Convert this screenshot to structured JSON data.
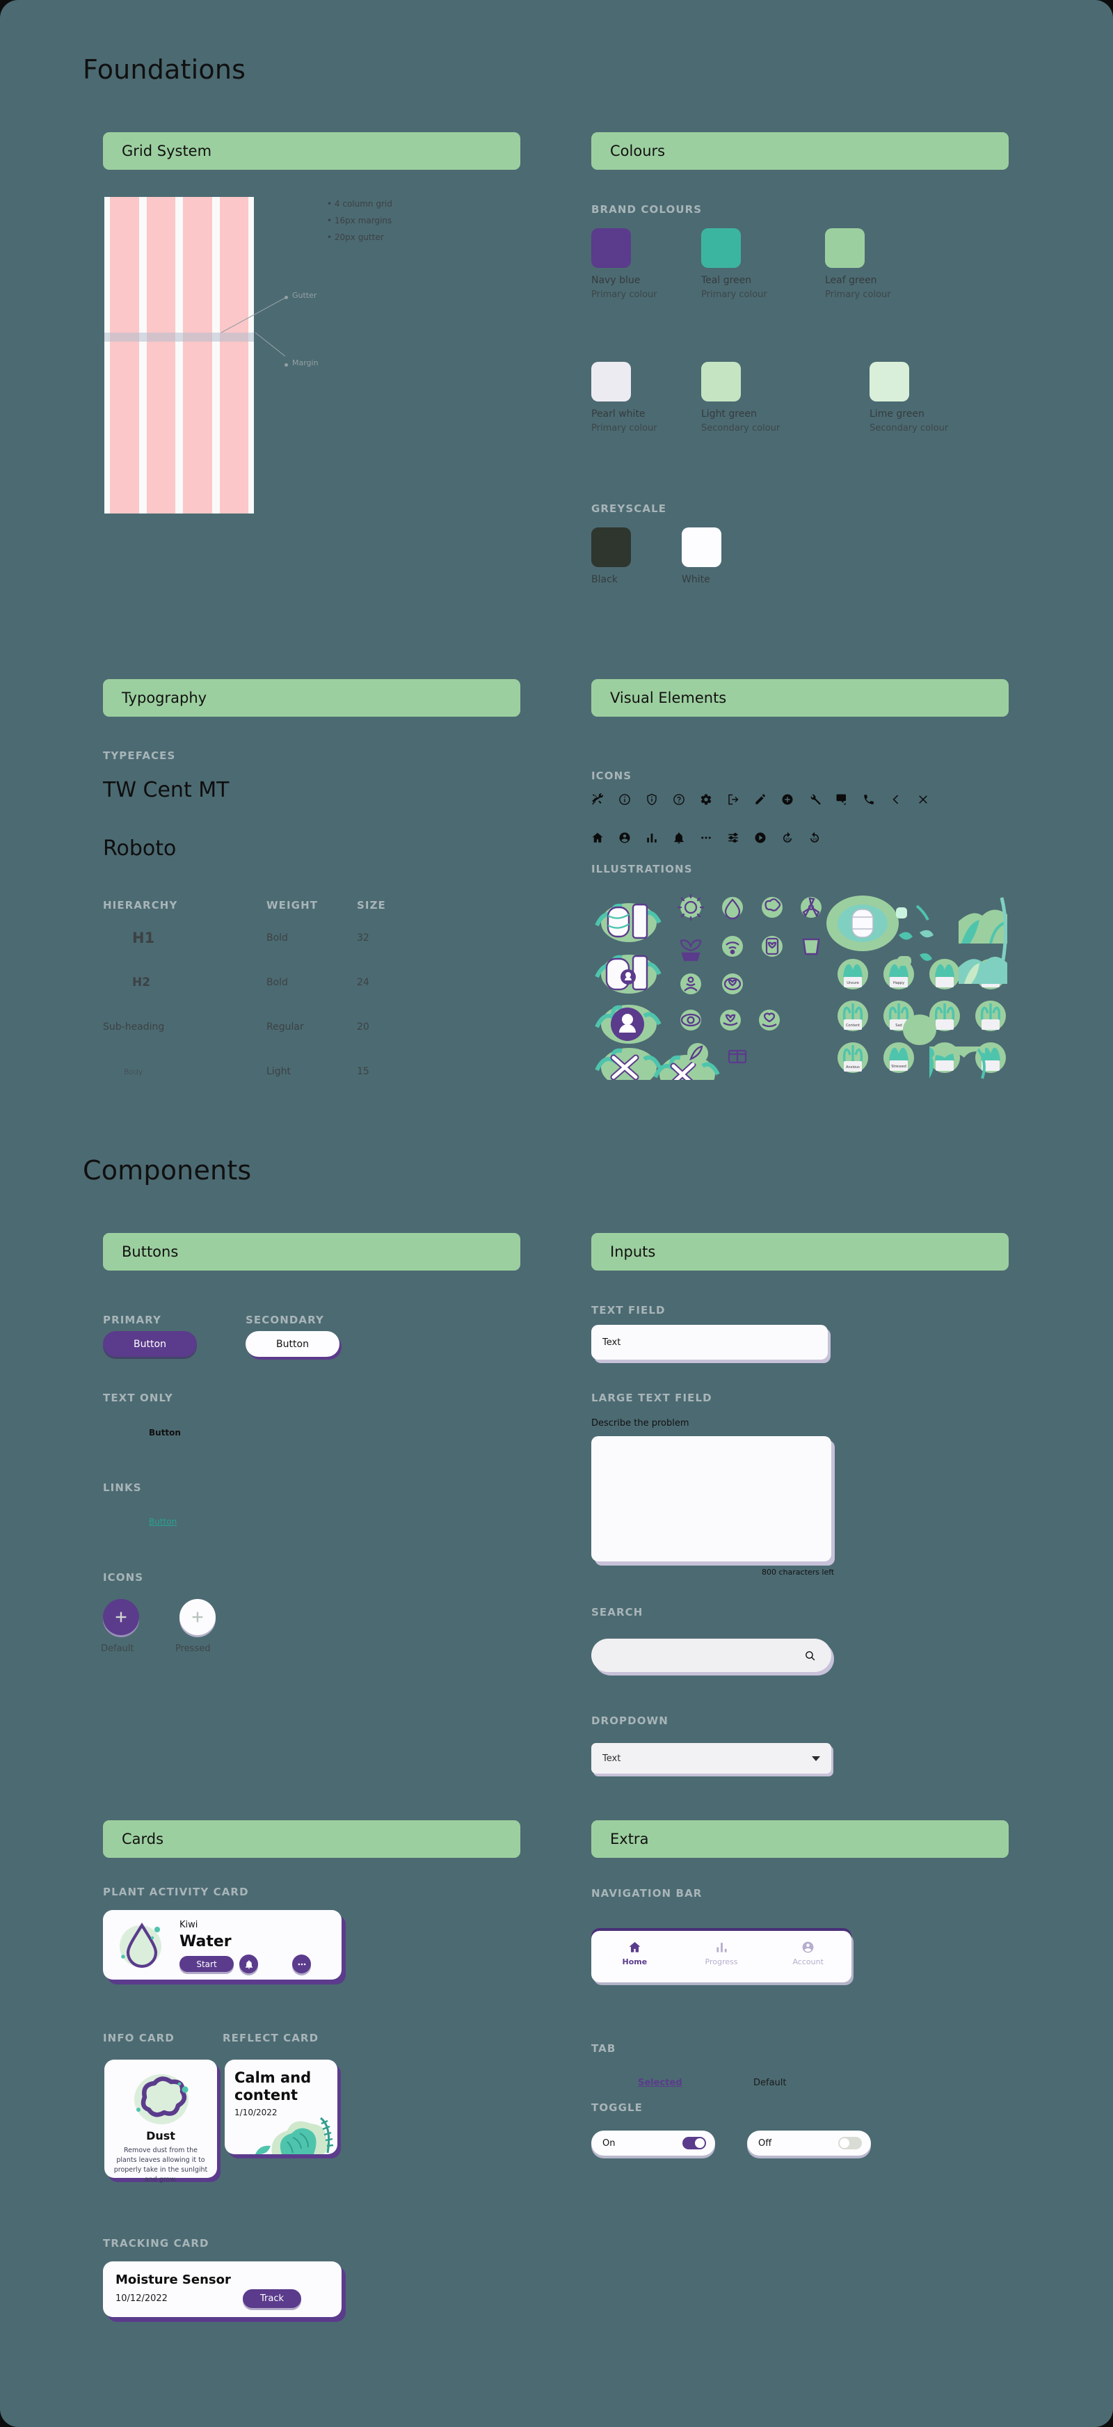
{
  "colors": {
    "canvas_bg": "#4c6a72",
    "panel_header": "#9ccf9f",
    "navy_blue": "#5b3b8c",
    "teal_green": "#3cb5a0",
    "leaf_green": "#9ccf9f",
    "pearl_white": "#edebf2",
    "light_green": "#c5e5c2",
    "lime_green": "#d9efd9",
    "black": "#2e362e",
    "white": "#fdfdff",
    "label_grey": "#a8b5b8",
    "grid_column": "#fbc7c8"
  },
  "sections": {
    "foundations_title": "Foundations",
    "components_title": "Components"
  },
  "grid_system": {
    "panel_title": "Grid System",
    "bullets": [
      "4 column grid",
      "16px margins",
      "20px gutter"
    ],
    "annotations": {
      "gutter": "Gutter",
      "margin": "Margin"
    },
    "columns": 4
  },
  "colours": {
    "panel_title": "Colours",
    "brand_label": "BRAND COLOURS",
    "greyscale_label": "GREYSCALE",
    "brand": [
      {
        "name": "Navy blue",
        "role": "Primary colour",
        "hex": "#5b3b8c"
      },
      {
        "name": "Teal green",
        "role": "Primary colour",
        "hex": "#3cb5a0"
      },
      {
        "name": "Leaf green",
        "role": "Primary colour",
        "hex": "#9ccf9f"
      },
      {
        "name": "Pearl white",
        "role": "Primary colour",
        "hex": "#edebf2"
      },
      {
        "name": "Light green",
        "role": "Secondary colour",
        "hex": "#c5e5c2"
      },
      {
        "name": "Lime green",
        "role": "Secondary colour",
        "hex": "#d9efd9"
      }
    ],
    "greyscale": [
      {
        "name": "Black",
        "hex": "#2e362e"
      },
      {
        "name": "White",
        "hex": "#fdfdff"
      }
    ]
  },
  "typography": {
    "panel_title": "Typography",
    "typefaces_label": "TYPEFACES",
    "typefaces": [
      "TW Cent MT",
      "Roboto"
    ],
    "table_headers": [
      "HIERARCHY",
      "WEIGHT",
      "SIZE"
    ],
    "rows": [
      {
        "hierarchy": "H1",
        "weight": "Bold",
        "size": "32"
      },
      {
        "hierarchy": "H2",
        "weight": "Bold",
        "size": "24"
      },
      {
        "hierarchy": "Sub-heading",
        "weight": "Regular",
        "size": "20"
      },
      {
        "hierarchy": "Body",
        "weight": "Light",
        "size": "15"
      }
    ]
  },
  "visual_elements": {
    "panel_title": "Visual Elements",
    "icons_label": "ICONS",
    "illustrations_label": "ILLUSTRATIONS",
    "icons_row1": [
      "tools-icon",
      "info-circle-icon",
      "shield-info-icon",
      "help-circle-icon",
      "gear-icon",
      "logout-icon",
      "pencil-icon",
      "add-circle-icon",
      "wrench-icon",
      "chat-icon",
      "phone-icon",
      "chevron-left-icon",
      "close-icon"
    ],
    "icons_row2": [
      "home-icon",
      "account-circle-icon",
      "bar-chart-icon",
      "bell-icon",
      "more-horizontal-icon",
      "tune-icon",
      "play-circle-icon",
      "forward-10-icon",
      "replay-10-icon"
    ]
  },
  "buttons": {
    "panel_title": "Buttons",
    "primary_label": "PRIMARY",
    "secondary_label": "SECONDARY",
    "text_only_label": "TEXT ONLY",
    "links_label": "LINKS",
    "icons_label": "ICONS",
    "primary_text": "Button",
    "secondary_text": "Button",
    "text_only_text": "Button",
    "link_text": "Button",
    "icon_default_caption": "Default",
    "icon_pressed_caption": "Pressed"
  },
  "inputs": {
    "panel_title": "Inputs",
    "text_field_label": "TEXT FIELD",
    "text_field_value": "Text",
    "large_text_field_label": "LARGE TEXT FIELD",
    "large_text_field_prompt": "Describe the problem",
    "large_text_field_counter": "800 characters left",
    "search_label": "SEARCH",
    "search_placeholder": "",
    "dropdown_label": "DROPDOWN",
    "dropdown_value": "Text"
  },
  "cards": {
    "panel_title": "Cards",
    "plant_activity_label": "PLANT ACTIVITY CARD",
    "plant_activity": {
      "plant_name": "Kiwi",
      "action": "Water",
      "start_button": "Start",
      "bell_icon": "bell-icon",
      "more_icon": "more-horizontal-icon"
    },
    "info_label": "INFO CARD",
    "info": {
      "title": "Dust",
      "body": "Remove dust from the plants leaves allowing it to properly take in the sunlgiht and grow."
    },
    "reflect_label": "REFLECT CARD",
    "reflect": {
      "title": "Calm and content",
      "date": "1/10/2022"
    },
    "tracking_label": "TRACKING CARD",
    "tracking": {
      "title": "Moisture Sensor",
      "date": "10/12/2022",
      "button": "Track"
    }
  },
  "extra": {
    "panel_title": "Extra",
    "navigation_bar_label": "NAVIGATION BAR",
    "nav_items": [
      {
        "label": "Home",
        "icon": "home-icon",
        "active": true
      },
      {
        "label": "Progress",
        "icon": "bar-chart-icon",
        "active": false
      },
      {
        "label": "Account",
        "icon": "account-circle-icon",
        "active": false
      }
    ],
    "tab_label": "TAB",
    "tab_selected": "Selected",
    "tab_default": "Default",
    "toggle_label": "TOGGLE",
    "toggle_on": "On",
    "toggle_off": "Off"
  }
}
